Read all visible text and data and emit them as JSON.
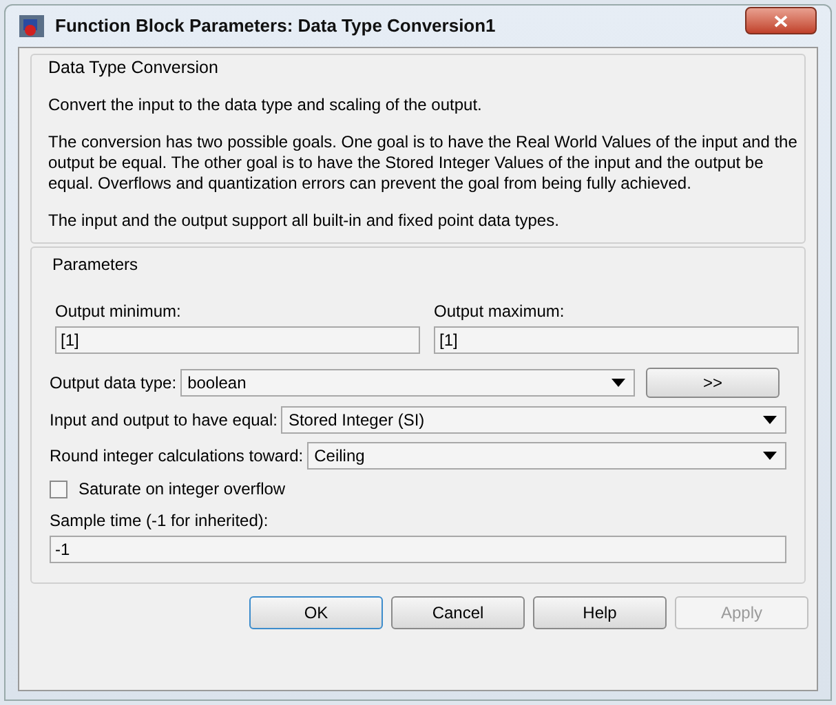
{
  "window": {
    "title": "Function Block Parameters: Data Type Conversion1"
  },
  "description": {
    "title": "Data Type Conversion",
    "paragraphs": [
      "Convert the input to the data type and scaling of the output.",
      "The conversion has two possible goals. One goal is to have the Real World Values of the input and the output be equal.  The other goal is to have the Stored Integer Values of the input and the output be equal.  Overflows and quantization errors can prevent the goal from being fully achieved.",
      "The input and the output support all built-in and fixed point data types."
    ]
  },
  "parameters": {
    "title": "Parameters",
    "output_minimum": {
      "label": "Output minimum:",
      "value": "[1]"
    },
    "output_maximum": {
      "label": "Output maximum:",
      "value": "[1]"
    },
    "output_data_type": {
      "label": "Output data type:",
      "value": "boolean",
      "button": ">>"
    },
    "equal": {
      "label": "Input and output to have equal:",
      "value": "Stored Integer (SI)"
    },
    "round": {
      "label": "Round integer calculations toward:",
      "value": "Ceiling"
    },
    "saturate": {
      "label": "Saturate on integer overflow",
      "checked": false
    },
    "sample_time": {
      "label": "Sample time (-1 for inherited):",
      "value": "-1"
    }
  },
  "buttons": [
    {
      "label": "OK",
      "default": true,
      "disabled": false
    },
    {
      "label": "Cancel",
      "default": false,
      "disabled": false
    },
    {
      "label": "Help",
      "default": false,
      "disabled": false
    },
    {
      "label": "Apply",
      "default": false,
      "disabled": true
    }
  ]
}
